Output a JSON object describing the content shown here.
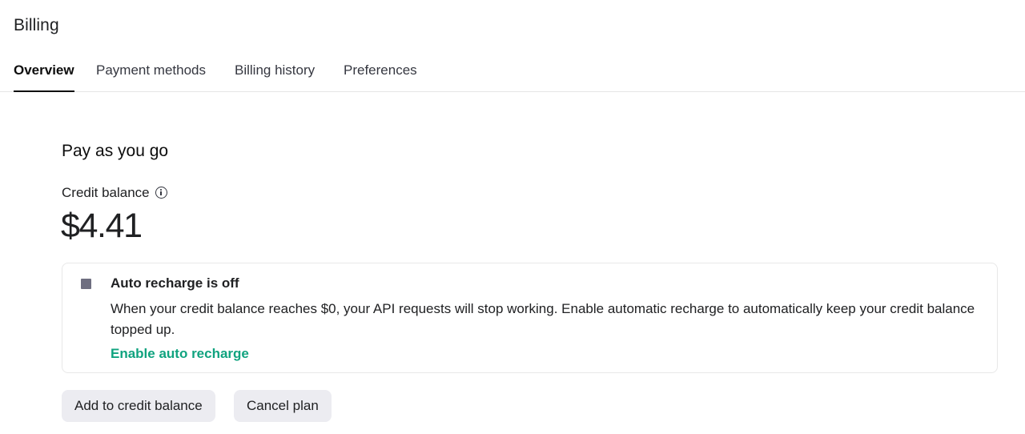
{
  "header": {
    "title": "Billing"
  },
  "tabs": [
    {
      "label": "Overview",
      "active": true
    },
    {
      "label": "Payment methods",
      "active": false
    },
    {
      "label": "Billing history",
      "active": false
    },
    {
      "label": "Preferences",
      "active": false
    }
  ],
  "main": {
    "section_title": "Pay as you go",
    "credit_label": "Credit balance",
    "credit_info_icon": "info-icon",
    "balance": "$4.41",
    "notice": {
      "icon": "stop-icon",
      "title": "Auto recharge is off",
      "body": "When your credit balance reaches $0, your API requests will stop working. Enable automatic recharge to automatically keep your credit balance topped up.",
      "link_label": "Enable auto recharge"
    },
    "buttons": {
      "add_credit": "Add to credit balance",
      "cancel_plan": "Cancel plan"
    }
  },
  "colors": {
    "accent_green": "#10a37f",
    "button_bg": "#ececf1",
    "text": "#202123",
    "border": "#e5e5e5"
  }
}
